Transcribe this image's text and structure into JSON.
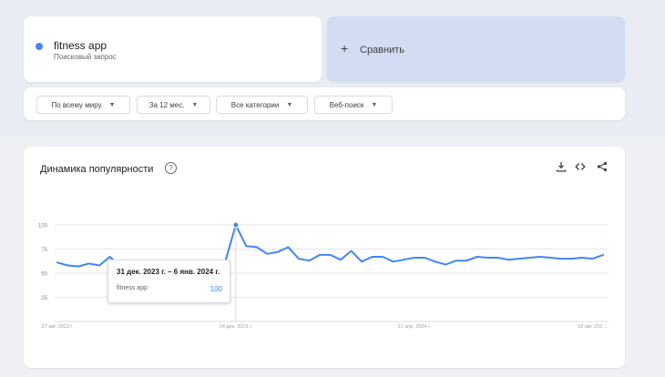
{
  "search_term": {
    "name": "fitness app",
    "type": "Поисковый запрос",
    "color": "#4285f4"
  },
  "compare": {
    "plus": "+",
    "label": "Сравнить"
  },
  "filters": {
    "region": "По всему миру",
    "time": "За 12 мес.",
    "category": "Все категории",
    "property": "Веб-поиск"
  },
  "chart_panel": {
    "title": "Динамика популярности",
    "help": "?"
  },
  "tooltip": {
    "date": "31 дек. 2023 г. – 6 янв. 2024 г.",
    "term": "fitness app",
    "value": "100"
  },
  "chart_data": {
    "type": "line",
    "y_ticks": [
      100,
      75,
      50,
      25
    ],
    "ylim": [
      0,
      100
    ],
    "x_labels": [
      {
        "label": "27 авг. 2023 г.",
        "index": 0
      },
      {
        "label": "24 дек. 2023 г.",
        "index": 17
      },
      {
        "label": "21 апр. 2024 г.",
        "index": 34
      },
      {
        "label": "18 авг. 202…",
        "index": 51
      }
    ],
    "grid": true,
    "series": [
      {
        "name": "fitness app",
        "color": "#4285f4",
        "values": [
          61,
          58,
          57,
          60,
          58,
          67,
          57,
          56,
          60,
          55,
          58,
          63,
          61,
          58,
          55,
          57,
          62,
          100,
          78,
          77,
          70,
          72,
          77,
          65,
          63,
          69,
          69,
          64,
          73,
          62,
          67,
          67,
          62,
          64,
          66,
          66,
          62,
          59,
          63,
          63,
          67,
          66,
          66,
          64,
          65,
          66,
          67,
          66,
          65,
          65,
          66,
          65,
          69
        ],
        "highlight_index": 17
      }
    ]
  }
}
